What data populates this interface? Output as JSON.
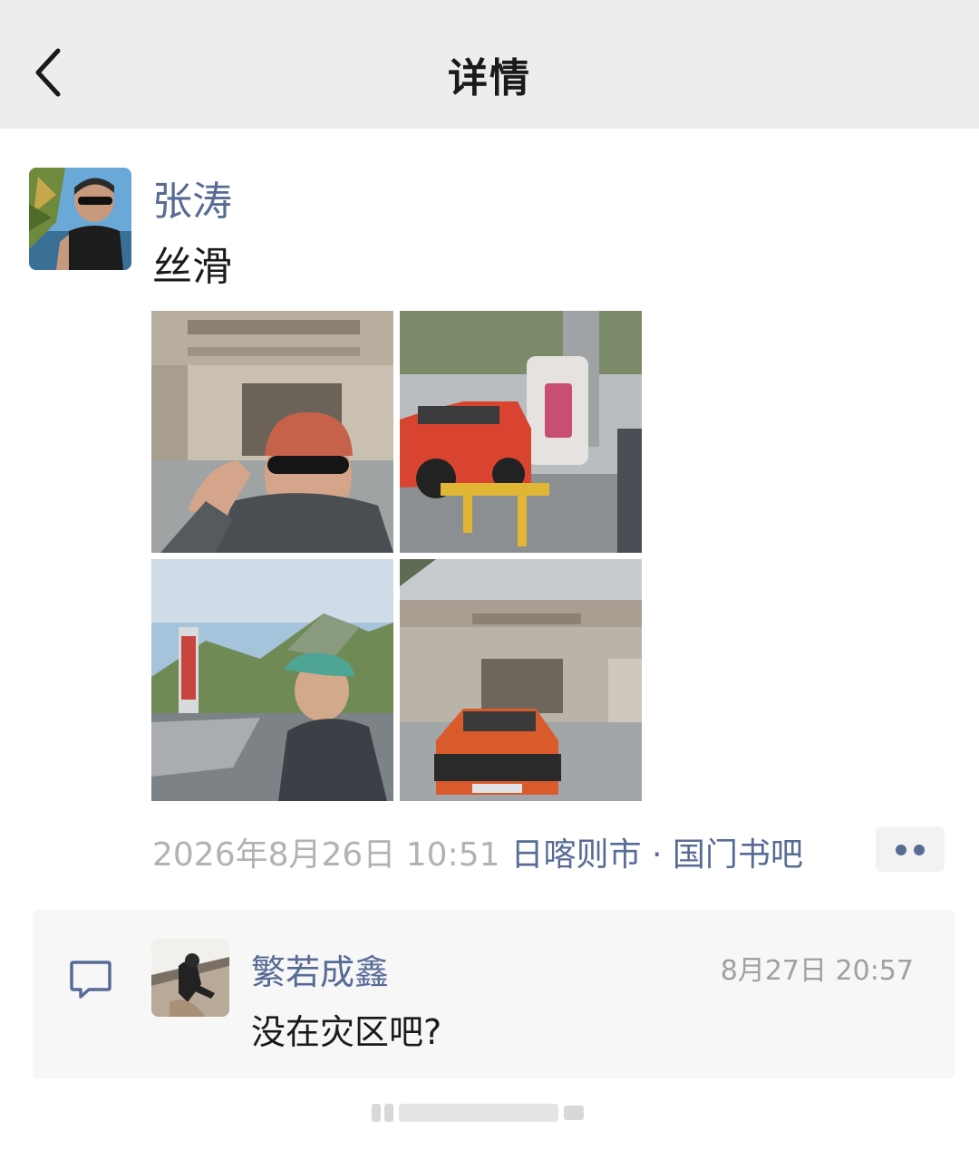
{
  "header": {
    "title": "详情",
    "back_icon": "chevron-left-icon"
  },
  "post": {
    "username": "张涛",
    "text": "丝滑",
    "photo_count": 4,
    "time": "2026年8月26日 10:51",
    "location": "日喀则市 · 国门书吧",
    "more_icon": "more-dots-icon"
  },
  "comment": {
    "icon": "comment-bubble-icon",
    "username": "繁若成鑫",
    "time": "8月27日 20:57",
    "text": "没在灾区吧?"
  },
  "colors": {
    "link": "#576b95",
    "header_bg": "#ededed",
    "comment_bg": "#f7f7f7",
    "meta_gray": "#b2b2b2"
  }
}
